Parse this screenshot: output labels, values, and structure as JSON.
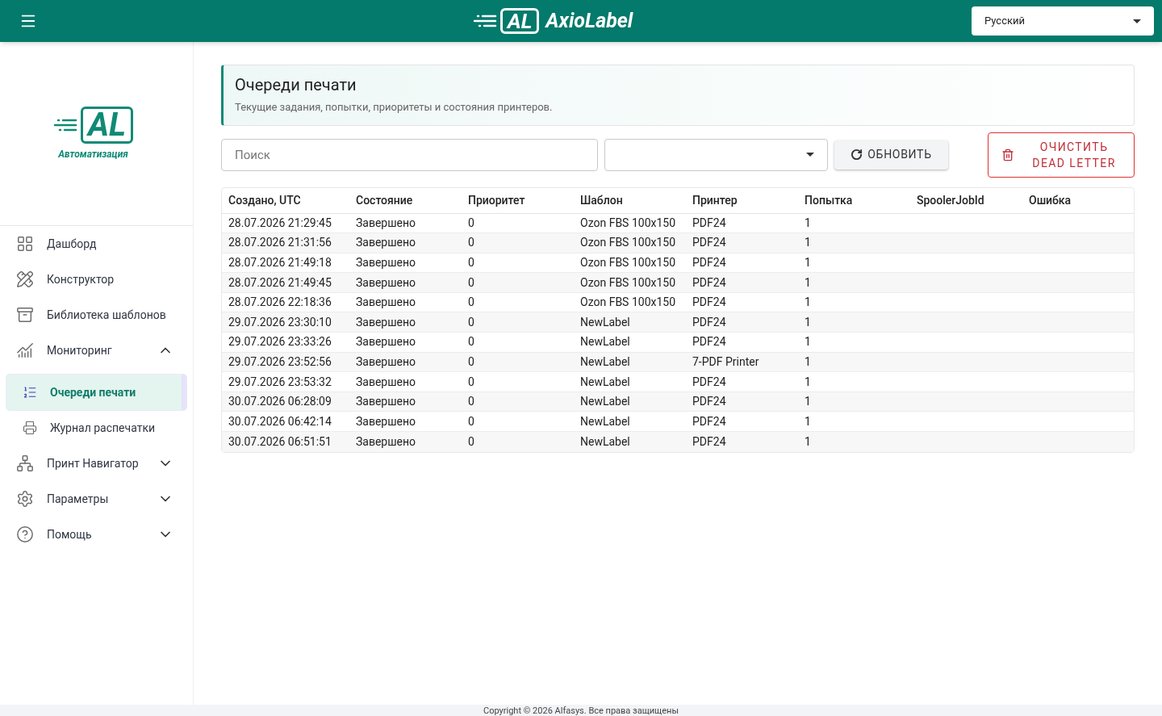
{
  "header": {
    "brand": "AxioLabel",
    "logo_letters": "AL",
    "language": "Русский"
  },
  "sidebar": {
    "logo_letters": "AL",
    "logo_caption": "Автоматизация",
    "items": [
      {
        "label": "Дашборд",
        "selected": false
      },
      {
        "label": "Конструктор",
        "selected": false
      },
      {
        "label": "Библиотека шаблонов",
        "selected": false
      },
      {
        "label": "Мониторинг",
        "selected": false,
        "expanded": true,
        "children": [
          {
            "label": "Очереди печати",
            "selected": true
          },
          {
            "label": "Журнал распечатки",
            "selected": false
          }
        ]
      },
      {
        "label": "Принт Навигатор",
        "selected": false,
        "expanded": false
      },
      {
        "label": "Параметры",
        "selected": false,
        "expanded": false
      },
      {
        "label": "Помощь",
        "selected": false,
        "expanded": false
      }
    ]
  },
  "page": {
    "title": "Очереди печати",
    "subtitle": "Текущие задания, попытки, приоритеты и состояния принтеров."
  },
  "toolbar": {
    "search": {
      "placeholder": "Поиск"
    },
    "refresh": "ОБНОВИТЬ",
    "clear": [
      "ОЧИСТИТЬ",
      "DEAD LETTER"
    ]
  },
  "table": {
    "columns": [
      "Создано, UTC",
      "Состояние",
      "Приоритет",
      "Шаблон",
      "Принтер",
      "Попытка",
      "SpoolerJobId",
      "Ошибка"
    ],
    "rows": [
      [
        "28.07.2026 21:29:45",
        "Завершено",
        "0",
        "Ozon FBS 100x150",
        "PDF24",
        "1"
      ],
      [
        "28.07.2026 21:31:56",
        "Завершено",
        "0",
        "Ozon FBS 100x150",
        "PDF24",
        "1"
      ],
      [
        "28.07.2026 21:49:18",
        "Завершено",
        "0",
        "Ozon FBS 100x150",
        "PDF24",
        "1"
      ],
      [
        "28.07.2026 21:49:45",
        "Завершено",
        "0",
        "Ozon FBS 100x150",
        "PDF24",
        "1"
      ],
      [
        "28.07.2026 22:18:36",
        "Завершено",
        "0",
        "Ozon FBS 100x150",
        "PDF24",
        "1"
      ],
      [
        "29.07.2026 23:30:10",
        "Завершено",
        "0",
        "NewLabel",
        "PDF24",
        "1"
      ],
      [
        "29.07.2026 23:33:26",
        "Завершено",
        "0",
        "NewLabel",
        "PDF24",
        "1"
      ],
      [
        "29.07.2026 23:52:56",
        "Завершено",
        "0",
        "NewLabel",
        "7-PDF Printer",
        "1"
      ],
      [
        "29.07.2026 23:53:32",
        "Завершено",
        "0",
        "NewLabel",
        "PDF24",
        "1"
      ],
      [
        "30.07.2026 06:28:09",
        "Завершено",
        "0",
        "NewLabel",
        "PDF24",
        "1"
      ],
      [
        "30.07.2026 06:42:14",
        "Завершено",
        "0",
        "NewLabel",
        "PDF24",
        "1"
      ],
      [
        "30.07.2026 06:51:51",
        "Завершено",
        "0",
        "NewLabel",
        "PDF24",
        "1"
      ]
    ]
  },
  "footer": "Copyright © 2026 Alfasys. Все права защищены"
}
